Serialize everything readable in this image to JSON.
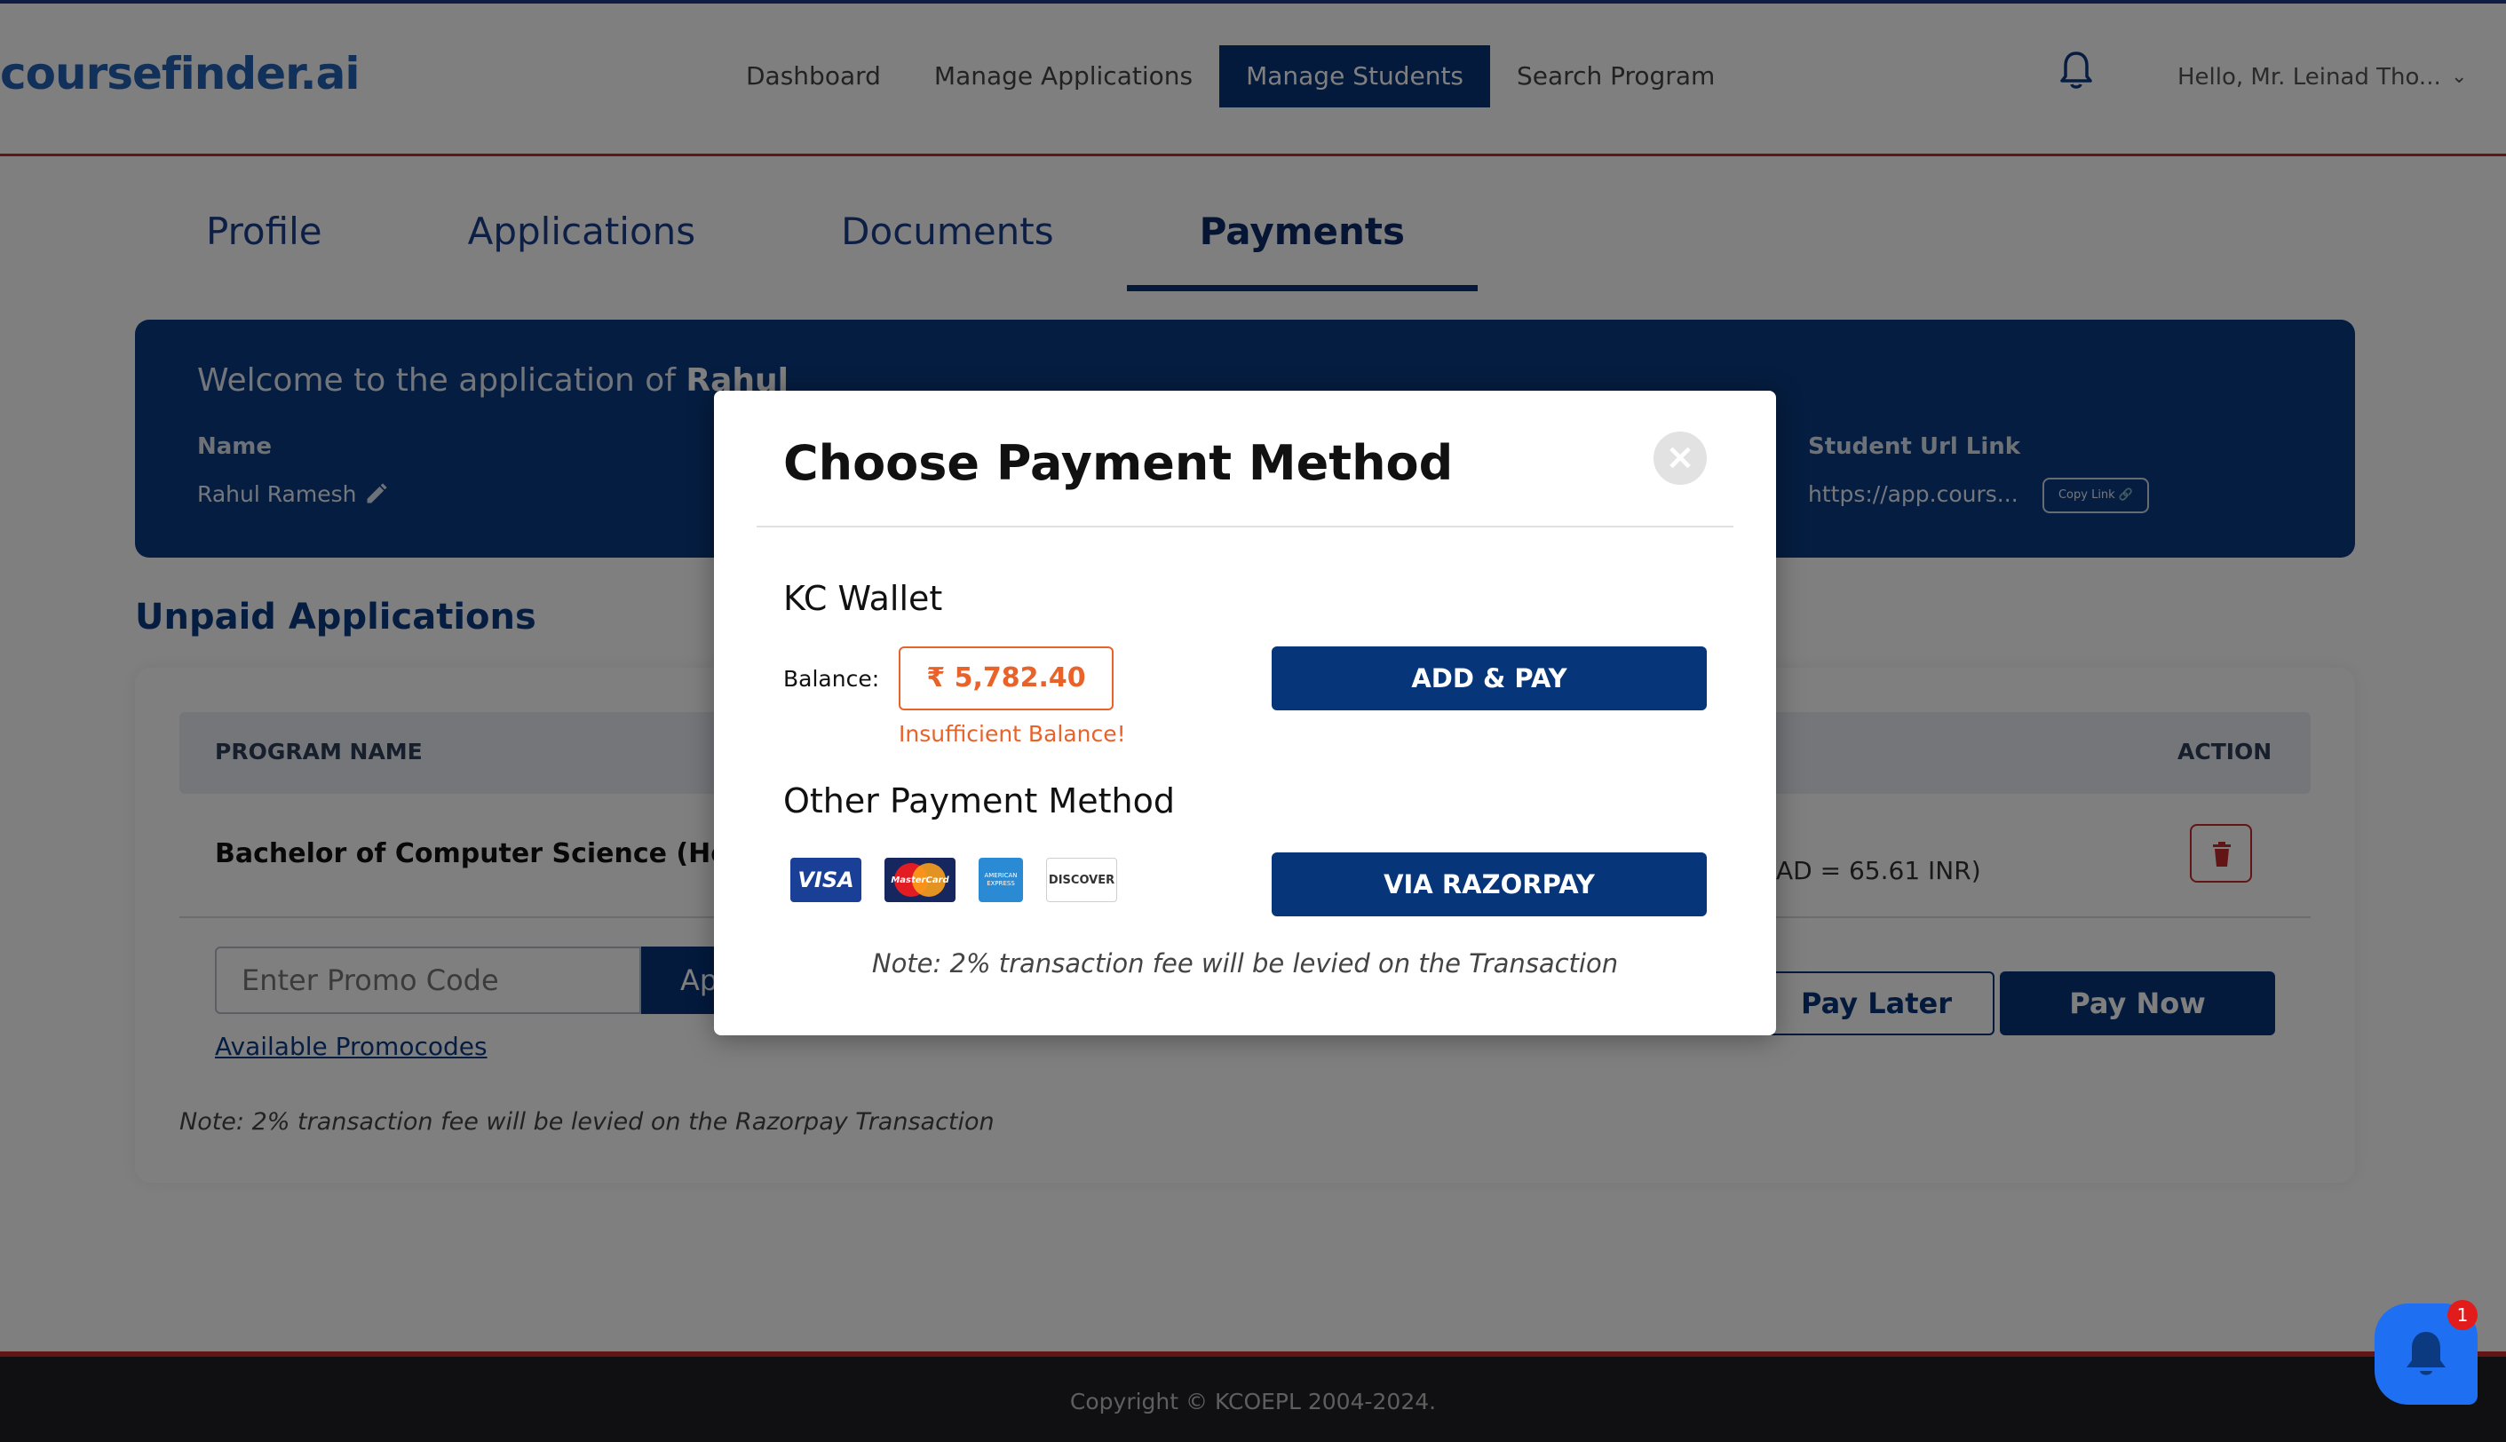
{
  "header": {
    "logo": "coursefinder.ai",
    "nav": [
      "Dashboard",
      "Manage Applications",
      "Manage Students",
      "Search Program"
    ],
    "active_nav": "Manage Students",
    "user_greeting": "Hello,  Mr. Leinad Tho..."
  },
  "tabs": [
    "Profile",
    "Applications",
    "Documents",
    "Payments"
  ],
  "active_tab": "Payments",
  "welcome": {
    "prefix": "Welcome to the application of ",
    "student": "Rahul",
    "name_label": "Name",
    "name_value": "Rahul Ramesh",
    "url_label": "Student Url Link",
    "url_value": "https://app.cours...",
    "copy_link": "Copy Link"
  },
  "unpaid": {
    "title": "Unpaid Applications",
    "col_program": "PROGRAM NAME",
    "col_action": "ACTION",
    "program": "Bachelor of Computer Science (Honour",
    "fee_fragment": "AD = 65.61 INR)",
    "promo_placeholder": "Enter Promo Code",
    "apply_fragment": "Ap",
    "promo_link": "Available Promocodes",
    "note": "Note: 2% transaction fee will be levied on the Razorpay Transaction",
    "pay_later": "Pay Later",
    "pay_now": "Pay Now"
  },
  "modal": {
    "title": "Choose Payment Method",
    "close": "×",
    "wallet_title": "KC Wallet",
    "balance_label": "Balance:",
    "balance_value": "₹ 5,782.40",
    "insufficient": "Insufficient Balance!",
    "add_pay": "ADD & PAY",
    "other_title": "Other Payment Method",
    "razorpay": "VIA RAZORPAY",
    "note": "Note: 2% transaction fee will be levied on the Transaction",
    "cards": [
      "VISA",
      "MasterCard",
      "AMERICAN EXPRESS",
      "DISCOVER"
    ]
  },
  "footer": {
    "copyright": "Copyright © KCOEPL 2004-2024."
  },
  "chat": {
    "badge": "1"
  },
  "colors": {
    "primary": "#06357a",
    "accent": "#2563b5",
    "warning": "#e8622a",
    "danger": "#c62828"
  }
}
